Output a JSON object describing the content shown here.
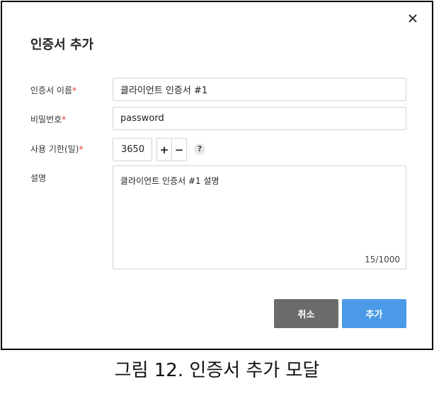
{
  "modal": {
    "title": "인증서 추가",
    "close_icon": "close-icon",
    "fields": {
      "name": {
        "label": "인증서 이름",
        "required_mark": "*",
        "value": "클라이언트 인증서 #1"
      },
      "password": {
        "label": "비밀번호",
        "required_mark": "*",
        "value": "password"
      },
      "validity": {
        "label": "사용 기한(일)",
        "required_mark": "*",
        "value": "3650",
        "plus": "+",
        "minus": "−",
        "help": "?"
      },
      "description": {
        "label": "설명",
        "value": "클라이언트 인증서 #1 설명",
        "counter": "15/1000"
      }
    },
    "buttons": {
      "cancel": "취소",
      "add": "추가"
    },
    "colors": {
      "required": "#e53935",
      "cancel_bg": "#6b6b6b",
      "add_bg": "#4a9ae8"
    }
  },
  "caption": "그림 12. 인증서 추가 모달"
}
